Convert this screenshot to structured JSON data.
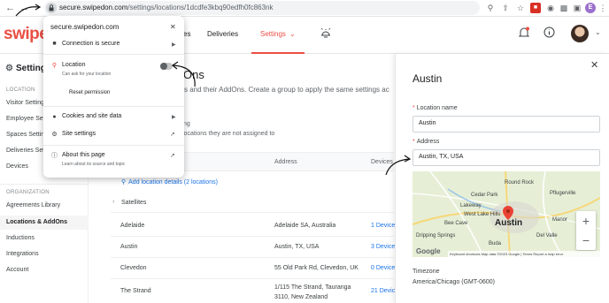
{
  "browser": {
    "url_host": "secure.swipedon.com",
    "url_path": "/settings/locations/1dcdfe3kbq90edfh0fc863nk",
    "profile_initial": "E"
  },
  "header": {
    "brand": "swipe",
    "nav": {
      "partial": "es",
      "deliveries": "Deliveries",
      "settings": "Settings"
    }
  },
  "left_nav": {
    "title": "Setting",
    "section_location": "LOCATION",
    "location_items": [
      "Visitor Setting",
      "Employee Set",
      "Spaces Settin",
      "Deliveries Set",
      "Devices"
    ],
    "section_org": "ORGANIZATION",
    "org_items": [
      "Agreements Library",
      "Locations & AddOns",
      "Inductions",
      "Integrations",
      "Account"
    ],
    "active": "Locations & AddOns"
  },
  "main": {
    "title_partial": "Ons",
    "subtitle_partial": "s and their AddOns. Create a group to apply the same settings ac",
    "label_partial_1": "ng",
    "label_partial_2": "locations they are not assigned to",
    "columns": {
      "address": "Address",
      "devices": "Devices"
    },
    "add_location": "Add location details (2 locations)",
    "satellites": "Satellites",
    "rows": [
      {
        "name": "Adelaide",
        "address": "Adelaide SA, Australia",
        "devices": "1 Device"
      },
      {
        "name": "Austin",
        "address": "Austin, TX, USA",
        "devices": "3 Devices"
      },
      {
        "name": "Clevedon",
        "address": "55 Old Park Rd, Clevedon, UK",
        "devices": "0 Device"
      },
      {
        "name": "The Strand",
        "address": "1/115 The Strand, Tauranga 3110, New Zealand",
        "devices": "21 Device"
      }
    ]
  },
  "drawer": {
    "title": "Austin",
    "location_name_label": "Location name",
    "location_name_value": "Austin",
    "address_label": "Address",
    "address_value": "Austin, TX, USA",
    "map": {
      "cities": [
        "Round Rock",
        "Pflugerville",
        "Cedar Park",
        "Lakeway",
        "West Lake Hills",
        "Austin",
        "Manor",
        "Bee Cave",
        "Del Valle",
        "Buda",
        "Dripping Springs"
      ],
      "google": "Google",
      "attribution": "Keyboard shortcuts   Map data ©2023 Google | Terms   Report a map error"
    },
    "timezone_label": "Timezone",
    "timezone_value": "America/Chicago (GMT-0600)"
  },
  "popup": {
    "domain": "secure.swipedon.com",
    "connection": "Connection is secure",
    "location_title": "Location",
    "location_sub": "Can ask for your location",
    "location_enabled": false,
    "reset": "Reset permission",
    "cookies": "Cookies and site data",
    "site_settings": "Site settings",
    "about_title": "About this page",
    "about_sub": "Learn about its source and topic"
  },
  "colors": {
    "brand": "#ea4f44",
    "link": "#1a73e8",
    "marker": "#ea4335"
  }
}
